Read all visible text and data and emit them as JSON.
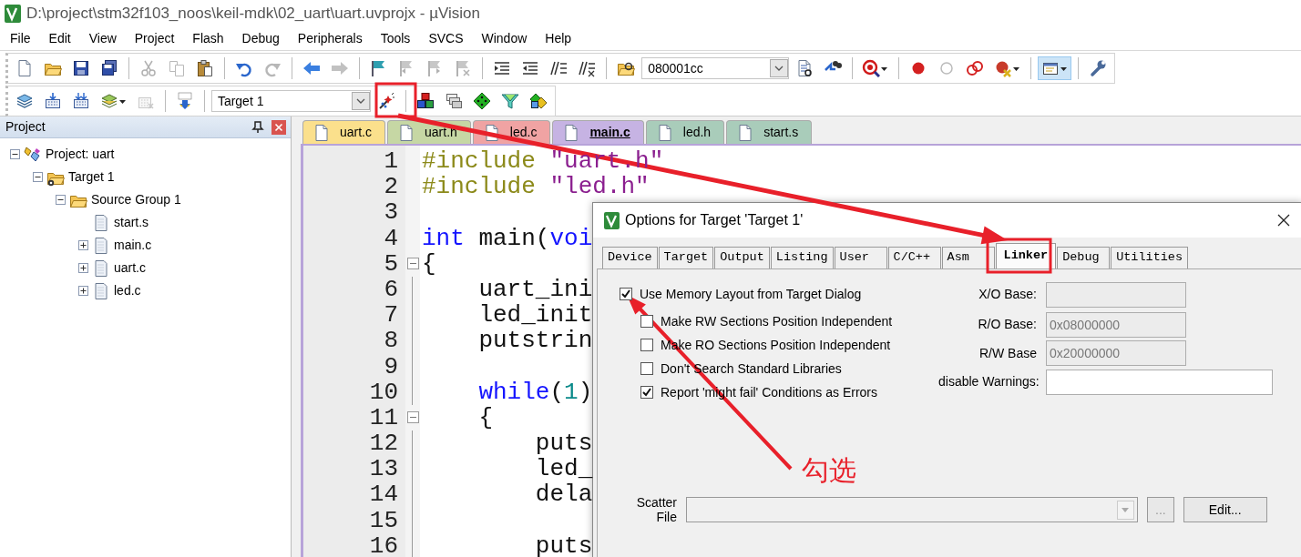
{
  "window": {
    "title": "D:\\project\\stm32f103_noos\\keil-mdk\\02_uart\\uart.uvprojx - µVision"
  },
  "menu": [
    "File",
    "Edit",
    "View",
    "Project",
    "Flash",
    "Debug",
    "Peripherals",
    "Tools",
    "SVCS",
    "Window",
    "Help"
  ],
  "toolbar_1": {
    "address": "080001cc",
    "buttons": [
      {
        "disabled": false,
        "pressed": false
      },
      {
        "disabled": false,
        "pressed": false
      },
      {
        "disabled": false,
        "pressed": false
      },
      {
        "disabled": false,
        "pressed": false
      },
      {
        "disabled": true,
        "pressed": false
      },
      {
        "disabled": true,
        "pressed": false
      },
      {
        "disabled": false,
        "pressed": false
      },
      {
        "disabled": false,
        "pressed": false
      },
      {
        "disabled": true,
        "pressed": false
      },
      {
        "disabled": false,
        "pressed": false
      },
      {
        "disabled": true,
        "pressed": false
      },
      {
        "disabled": false,
        "pressed": false
      },
      {
        "disabled": true,
        "pressed": false
      },
      {
        "disabled": true,
        "pressed": false
      },
      {
        "disabled": true,
        "pressed": false
      },
      {
        "disabled": false,
        "pressed": false
      },
      {
        "disabled": false,
        "pressed": false
      },
      {
        "disabled": false,
        "pressed": false
      },
      {
        "disabled": false,
        "pressed": false
      },
      {
        "disabled": false,
        "pressed": false
      },
      {
        "disabled": false,
        "pressed": false
      },
      {
        "disabled": false,
        "pressed": false
      },
      {
        "disabled": false,
        "pressed": false
      },
      {
        "disabled": false,
        "pressed": false
      },
      {
        "disabled": false,
        "pressed": false
      },
      {
        "disabled": false,
        "pressed": false
      },
      {
        "disabled": false,
        "pressed": false
      },
      {
        "disabled": false,
        "pressed": true
      },
      {
        "disabled": false,
        "pressed": false
      }
    ]
  },
  "toolbar_2": {
    "target": "Target 1",
    "buttons": [
      {
        "disabled": false,
        "pressed": false
      },
      {
        "disabled": false,
        "pressed": false
      },
      {
        "disabled": false,
        "pressed": false
      },
      {
        "disabled": false,
        "pressed": false
      },
      {
        "disabled": true,
        "pressed": false
      },
      {
        "disabled": false,
        "pressed": false
      },
      {
        "disabled": false,
        "pressed": false
      },
      {
        "disabled": false,
        "pressed": false
      },
      {
        "disabled": false,
        "pressed": false
      },
      {
        "disabled": false,
        "pressed": false
      },
      {
        "disabled": false,
        "pressed": false
      },
      {
        "disabled": false,
        "pressed": false
      }
    ]
  },
  "project_panel": {
    "title": "Project",
    "tree": [
      {
        "label": "Project: uart",
        "kind": "project",
        "expanded": true,
        "children": [
          {
            "label": "Target 1",
            "kind": "target",
            "expanded": true,
            "children": [
              {
                "label": "Source Group 1",
                "kind": "group",
                "expanded": true,
                "children": [
                  {
                    "label": "start.s",
                    "kind": "file"
                  },
                  {
                    "label": "main.c",
                    "kind": "file",
                    "expanded": false
                  },
                  {
                    "label": "uart.c",
                    "kind": "file",
                    "expanded": false
                  },
                  {
                    "label": "led.c",
                    "kind": "file",
                    "expanded": false
                  }
                ]
              }
            ]
          }
        ]
      }
    ]
  },
  "editor": {
    "tabs": [
      {
        "label": "uart.c",
        "color": "#fbe08c",
        "selected": false
      },
      {
        "label": "uart.h",
        "color": "#c6d7a4",
        "selected": false
      },
      {
        "label": "led.c",
        "color": "#f0a3a3",
        "selected": false
      },
      {
        "label": "main.c",
        "color": "#c6b3e3",
        "selected": true
      },
      {
        "label": "led.h",
        "color": "#a9ccba",
        "selected": false
      },
      {
        "label": "start.s",
        "color": "#a9ccba",
        "selected": false
      }
    ],
    "lines": [
      {
        "number": "1",
        "foldable": false,
        "tokens": [
          {
            "kind": "preproc",
            "text": "#include"
          },
          {
            "kind": "string",
            "text": " \"uart.h\""
          }
        ]
      },
      {
        "number": "2",
        "foldable": false,
        "tokens": [
          {
            "kind": "preproc",
            "text": "#include"
          },
          {
            "kind": "string",
            "text": " \"led.h\""
          }
        ]
      },
      {
        "number": "3",
        "foldable": false
      },
      {
        "number": "4",
        "foldable": false,
        "tokens": [
          {
            "kind": "keyword",
            "text": "int"
          },
          {
            "kind": "plain",
            "text": " main("
          },
          {
            "kind": "keyword",
            "text": "voi"
          }
        ]
      },
      {
        "number": "5",
        "foldable": true,
        "tokens": [
          {
            "kind": "plain",
            "text": "{"
          }
        ]
      },
      {
        "number": "6",
        "foldable": false,
        "tokens": [
          {
            "kind": "plain",
            "text": "    uart_ini"
          }
        ]
      },
      {
        "number": "7",
        "foldable": false,
        "tokens": [
          {
            "kind": "plain",
            "text": "    led_init"
          }
        ]
      },
      {
        "number": "8",
        "foldable": false,
        "tokens": [
          {
            "kind": "plain",
            "text": "    putstrin"
          }
        ]
      },
      {
        "number": "9",
        "foldable": false
      },
      {
        "number": "10",
        "foldable": false,
        "tokens": [
          {
            "kind": "keyword",
            "text": "    while"
          },
          {
            "kind": "plain",
            "text": "("
          },
          {
            "kind": "number",
            "text": "1"
          },
          {
            "kind": "plain",
            "text": ")"
          }
        ]
      },
      {
        "number": "11",
        "foldable": true,
        "tokens": [
          {
            "kind": "plain",
            "text": "    {"
          }
        ]
      },
      {
        "number": "12",
        "foldable": false,
        "tokens": [
          {
            "kind": "plain",
            "text": "        puts"
          }
        ]
      },
      {
        "number": "13",
        "foldable": false,
        "tokens": [
          {
            "kind": "plain",
            "text": "        led_"
          }
        ]
      },
      {
        "number": "14",
        "foldable": false,
        "tokens": [
          {
            "kind": "plain",
            "text": "        dela"
          }
        ]
      },
      {
        "number": "15",
        "foldable": false
      },
      {
        "number": "16",
        "foldable": false,
        "tokens": [
          {
            "kind": "plain",
            "text": "        puts"
          }
        ]
      }
    ]
  },
  "dialog": {
    "title": "Options for Target 'Target 1'",
    "tabs": [
      {
        "label": "Device",
        "selected": false
      },
      {
        "label": "Target",
        "selected": false
      },
      {
        "label": "Output",
        "selected": false
      },
      {
        "label": "Listing",
        "selected": false
      },
      {
        "label": "User",
        "selected": false
      },
      {
        "label": "C/C++",
        "selected": false
      },
      {
        "label": "Asm",
        "selected": false
      },
      {
        "label": "Linker",
        "selected": true
      },
      {
        "label": "Debug",
        "selected": false
      },
      {
        "label": "Utilities",
        "selected": false
      }
    ],
    "options": [
      {
        "label": "Use Memory Layout from Target Dialog",
        "checked": true
      },
      {
        "label": "Make RW Sections Position Independent",
        "checked": false
      },
      {
        "label": "Make RO Sections Position Independent",
        "checked": false
      },
      {
        "label": "Don't Search Standard Libraries",
        "checked": false
      },
      {
        "label": "Report 'might fail' Conditions as Errors",
        "checked": true
      }
    ],
    "fields": [
      {
        "label": "X/O Base:",
        "disabled": true
      },
      {
        "label": "R/O Base:",
        "value": "0x08000000",
        "disabled": true
      },
      {
        "label": "R/W Base",
        "value": "0x20000000",
        "disabled": true
      },
      {
        "label": "disable Warnings:",
        "disabled": false
      }
    ],
    "scatter": {
      "label": "Scatter File",
      "disabled": true
    },
    "buttons": [
      {
        "label": "...",
        "disabled": true
      },
      {
        "label": "Edit...",
        "disabled": false
      }
    ]
  },
  "annotation": {
    "note": "勾选"
  }
}
